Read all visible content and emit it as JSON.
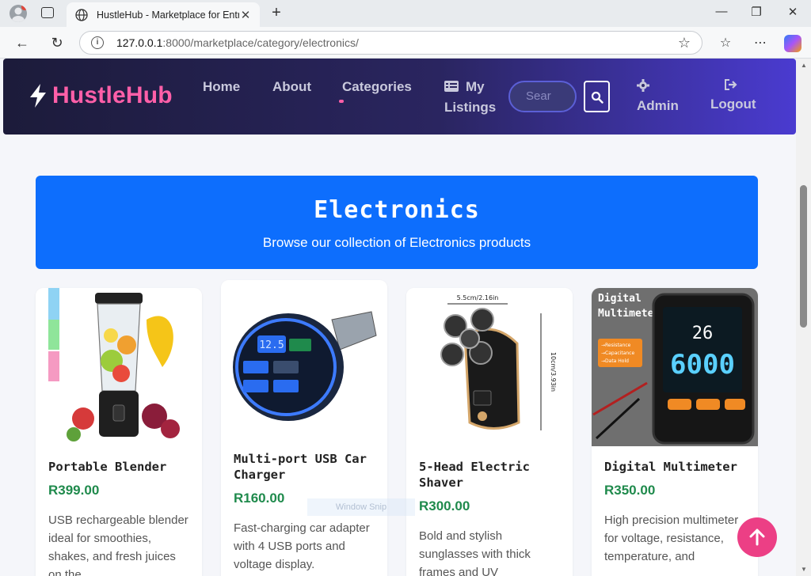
{
  "browser": {
    "tab_title": "HustleHub - Marketplace for Entr",
    "url_host": "127.0.0.1",
    "url_path": ":8000/marketplace/category/electronics/"
  },
  "nav": {
    "brand": "HustleHub",
    "links": {
      "home": "Home",
      "about": "About",
      "categories": "Categories",
      "my": "My",
      "listings": "Listings",
      "admin": "Admin",
      "logout": "Logout"
    },
    "search_placeholder": "Sear"
  },
  "hero": {
    "title": "Electronics",
    "subtitle": "Browse our collection of Electronics products"
  },
  "products": [
    {
      "title": "Portable Blender",
      "price": "R399.00",
      "desc": "USB rechargeable blender ideal for smoothies, shakes, and fresh juices on the"
    },
    {
      "title": "Multi-port USB Car Charger",
      "price": "R160.00",
      "desc": "Fast-charging car adapter with 4 USB ports and voltage display."
    },
    {
      "title": "5-Head Electric Shaver",
      "price": "R300.00",
      "desc": "Bold and stylish sunglasses with thick frames and UV"
    },
    {
      "title": "Digital Multimeter",
      "price": "R350.00",
      "desc": "High precision multimeter for voltage, resistance, temperature, and"
    }
  ],
  "product_images": {
    "shaver_dim_width": "5.5cm/2.16in",
    "shaver_dim_height": "10cm/3.93in",
    "multimeter_label_1": "Digital",
    "multimeter_label_2": "Multimeter",
    "multimeter_features": [
      "→Resistance",
      "→Capacitance",
      "→Data Hold"
    ],
    "multimeter_reading": "6000",
    "multimeter_small_reading": "26",
    "charger_reading": "12.5"
  },
  "overlay": {
    "snip_label": "Window Snip"
  },
  "colors": {
    "accent_pink": "#ff5fa8",
    "hero_blue": "#0d6efd",
    "price_green": "#1f8a4c",
    "fab_pink": "#ec3f85"
  }
}
